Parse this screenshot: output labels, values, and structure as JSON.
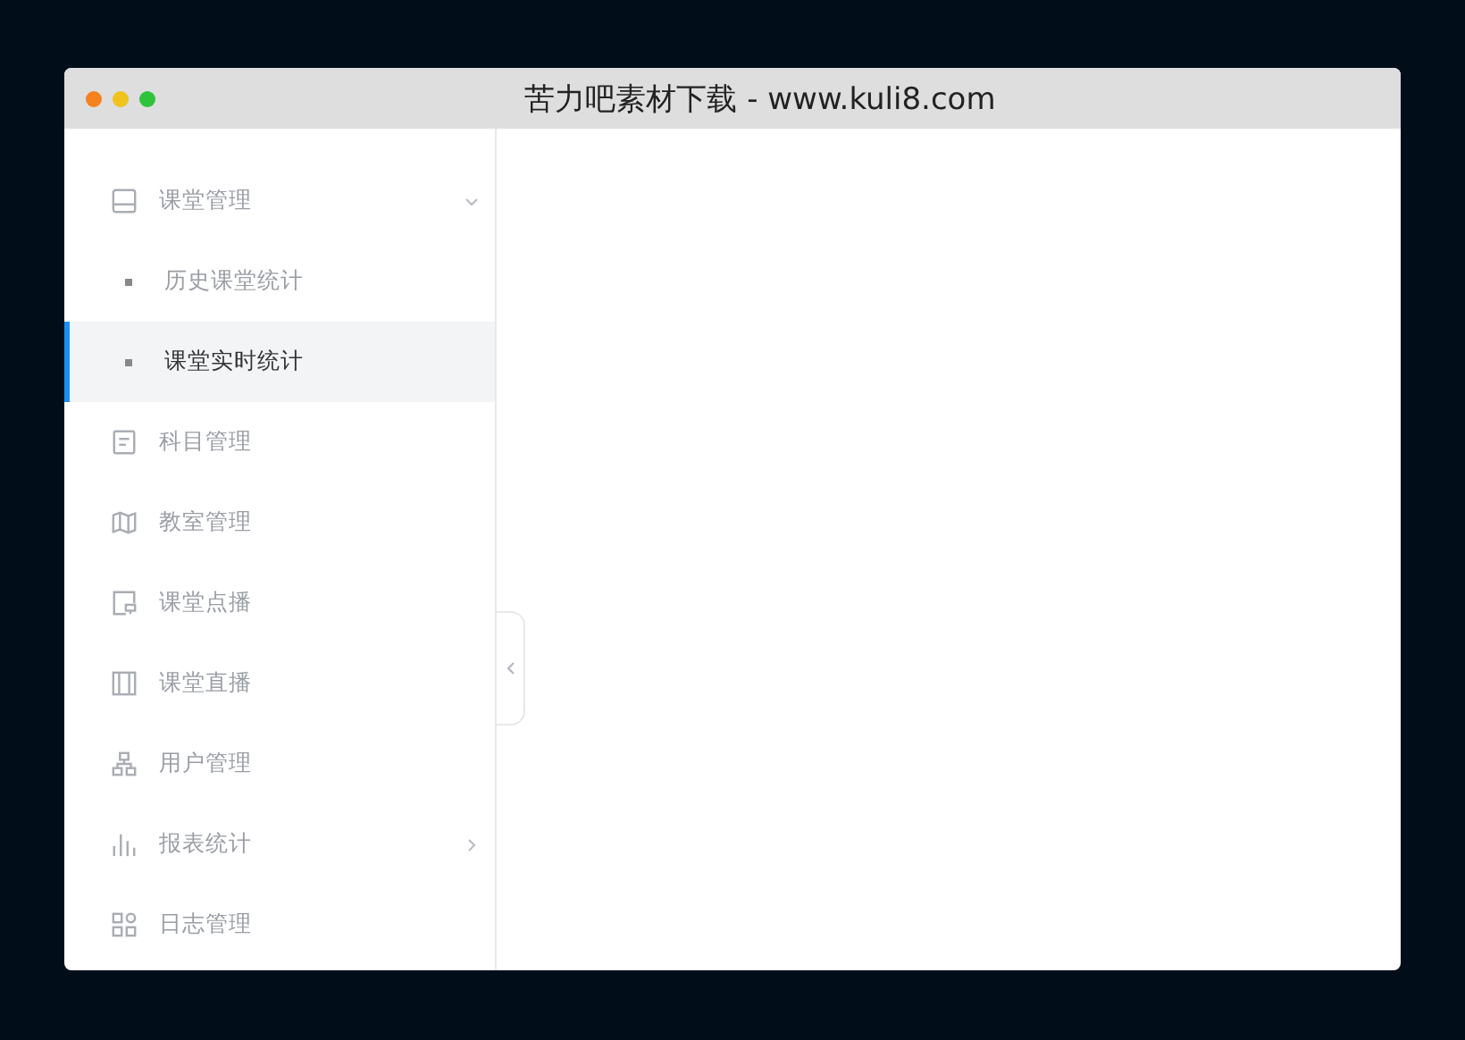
{
  "window": {
    "title": "苦力吧素材下载 - www.kuli8.com"
  },
  "menu": [
    {
      "kind": "group",
      "label": "课堂管理",
      "expanded": true,
      "children": [
        {
          "label": "历史课堂统计",
          "selected": false
        },
        {
          "label": "课堂实时统计",
          "selected": true
        }
      ]
    },
    {
      "kind": "item",
      "label": "科目管理"
    },
    {
      "kind": "item",
      "label": "教室管理"
    },
    {
      "kind": "item",
      "label": "课堂点播"
    },
    {
      "kind": "item",
      "label": "课堂直播"
    },
    {
      "kind": "item",
      "label": "用户管理"
    },
    {
      "kind": "group",
      "label": "报表统计",
      "expanded": false
    },
    {
      "kind": "item",
      "label": "日志管理"
    }
  ]
}
